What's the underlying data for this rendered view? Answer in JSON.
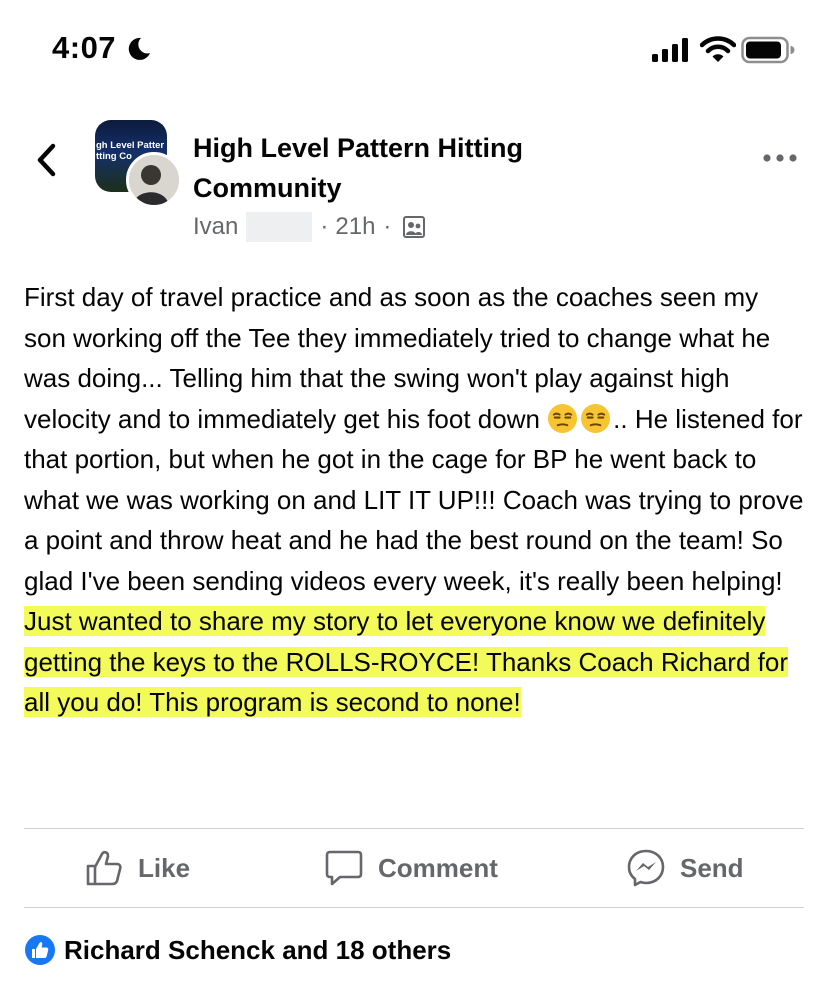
{
  "status_bar": {
    "time": "4:07"
  },
  "post": {
    "group_name": "High Level Pattern Hitting Community",
    "group_avatar_text_line1": "gh Level Patter",
    "group_avatar_text_line2": "tting Co",
    "author": "Ivan",
    "time": "21h",
    "body": {
      "p1": "First day of travel practice and as soon as the coaches seen my son working off the Tee they immediately tried to change what he was doing... Telling him that the swing won't play against high velocity and to immediately get his foot down ",
      "p2": ".. He listened for that portion, but when he got in the cage for BP he went back to what we was working on and LIT IT UP!!! Coach was trying to prove a point and throw heat and he had the best round on the team! So glad I've been sending videos every week, it's really been helping! ",
      "highlighted": "Just wanted to share my story to let everyone know we definitely getting the keys to the ROLLS-ROYCE!  Thanks Coach Richard for all you do! This program is second to none!"
    }
  },
  "actions": {
    "like": "Like",
    "comment": "Comment",
    "send": "Send"
  },
  "reactions": {
    "summary": "Richard Schenck and 18 others"
  },
  "colors": {
    "highlight": "#f3fb5b",
    "facebook_blue": "#1877f2",
    "secondary_text": "#65676b"
  }
}
